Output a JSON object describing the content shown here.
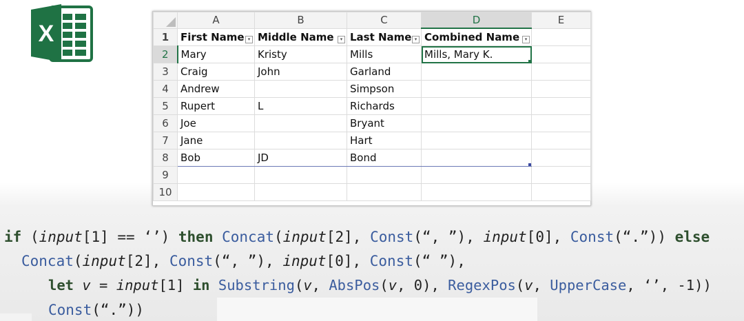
{
  "sheet": {
    "columns": [
      "A",
      "B",
      "C",
      "D",
      "E"
    ],
    "header_row": {
      "num": "1",
      "cells": [
        "First Name",
        "Middle Name",
        "Last Name",
        "Combined Name",
        ""
      ]
    },
    "rows": [
      {
        "num": "2",
        "cells": [
          "Mary",
          "Kristy",
          "Mills",
          "Mills, Mary K.",
          ""
        ]
      },
      {
        "num": "3",
        "cells": [
          "Craig",
          "John",
          "Garland",
          "",
          ""
        ]
      },
      {
        "num": "4",
        "cells": [
          "Andrew",
          "",
          "Simpson",
          "",
          ""
        ]
      },
      {
        "num": "5",
        "cells": [
          "Rupert",
          "L",
          "Richards",
          "",
          ""
        ]
      },
      {
        "num": "6",
        "cells": [
          "Joe",
          "",
          "Bryant",
          "",
          ""
        ]
      },
      {
        "num": "7",
        "cells": [
          "Jane",
          "",
          "Hart",
          "",
          ""
        ]
      },
      {
        "num": "8",
        "cells": [
          "Bob",
          "JD",
          "Bond",
          "",
          ""
        ]
      },
      {
        "num": "9",
        "cells": [
          "",
          "",
          "",
          "",
          ""
        ]
      },
      {
        "num": "10",
        "cells": [
          "",
          "",
          "",
          "",
          ""
        ]
      }
    ],
    "filter_glyph": "▾",
    "accent_color": "#217346"
  },
  "logo": {
    "letter": "X",
    "icon": "excel-logo-icon",
    "color": "#1f7244"
  },
  "code": {
    "line1": {
      "t1": "if",
      "t2": " (",
      "t3": "input",
      "t4": "[1] == ‘’) ",
      "t5": "then",
      "t6": " ",
      "t7": "Concat",
      "t8": "(",
      "t9": "input",
      "t10": "[2], ",
      "t11": "Const",
      "t12": "(“, ”), ",
      "t13": "input",
      "t14": "[0], ",
      "t15": "Const",
      "t16": "(“.”)) ",
      "t17": "else"
    },
    "line2": {
      "t1": "Concat",
      "t2": "(",
      "t3": "input",
      "t4": "[2], ",
      "t5": "Const",
      "t6": "(“, ”), ",
      "t7": "input",
      "t8": "[0], ",
      "t9": "Const",
      "t10": "(“ ”),"
    },
    "line3": {
      "t1": "let",
      "t2": " ",
      "t3": "v",
      "t4": " = ",
      "t5": "input",
      "t6": "[1] ",
      "t7": "in",
      "t8": " ",
      "t9": "Substring",
      "t10": "(",
      "t11": "v",
      "t12": ", ",
      "t13": "AbsPos",
      "t14": "(",
      "t15": "v",
      "t16": ", 0), ",
      "t17": "RegexPos",
      "t18": "(",
      "t19": "v",
      "t20": ", ",
      "t21": "UpperCase",
      "t22": ", ‘’, -1))"
    },
    "line4": {
      "t1": "Const",
      "t2": "(“.”))"
    }
  }
}
